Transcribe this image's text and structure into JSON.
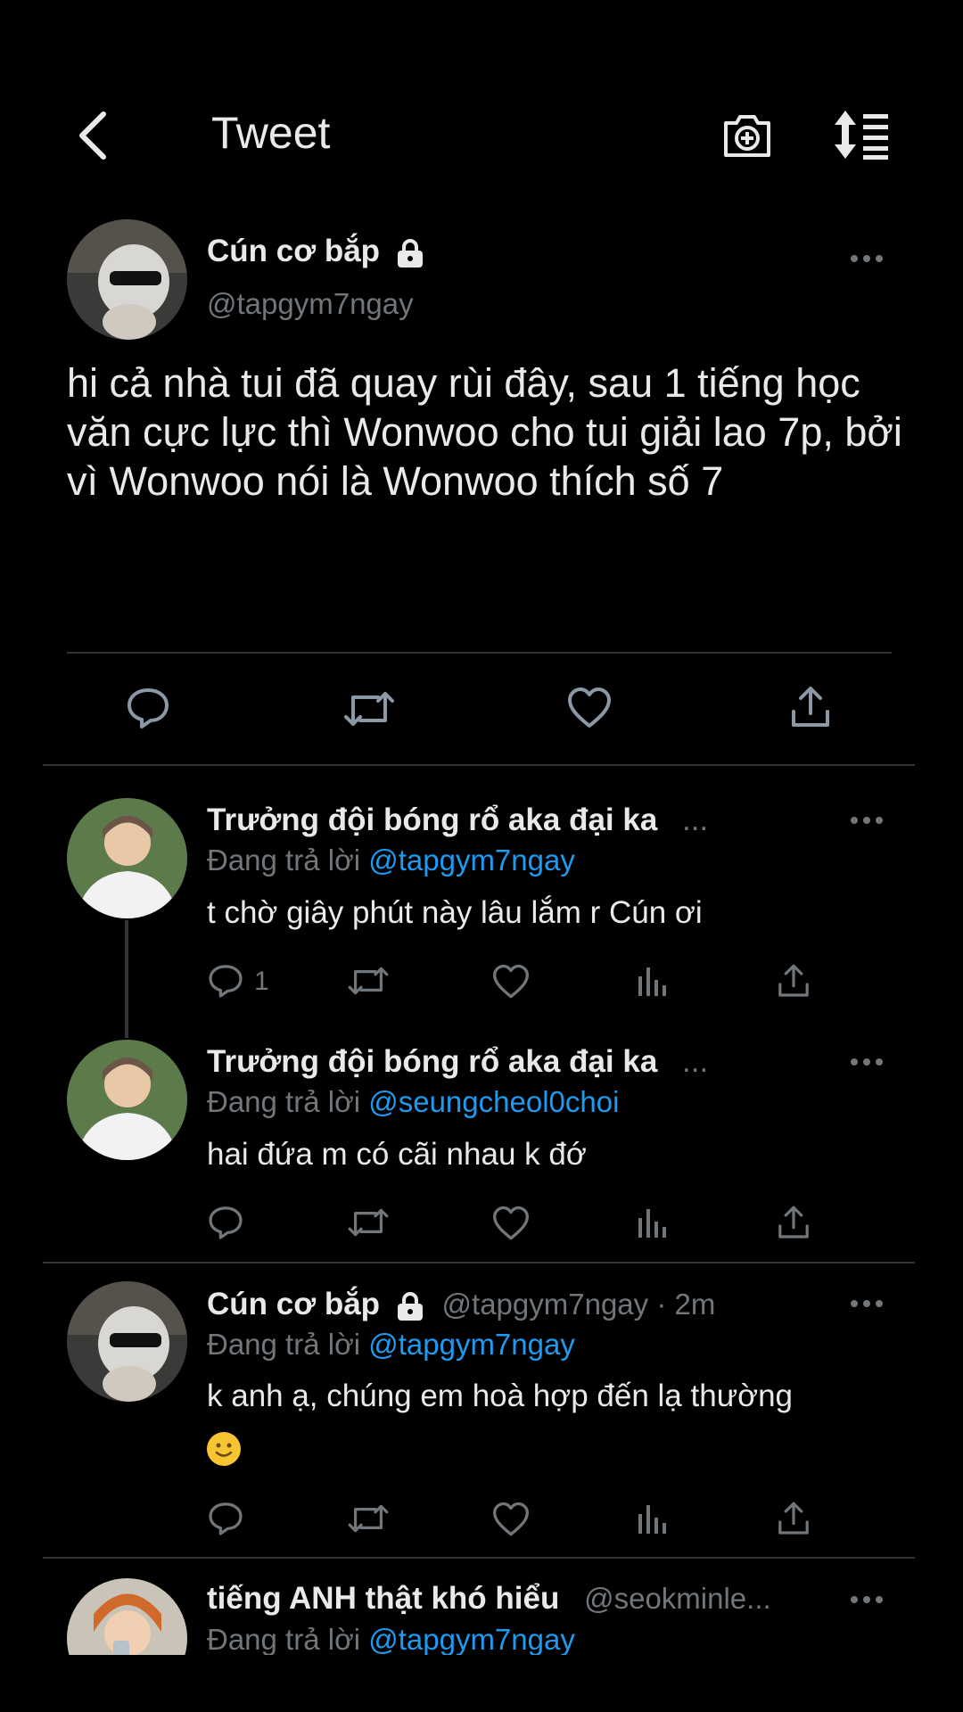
{
  "header": {
    "title": "Tweet",
    "back_icon": "chevron-left-icon",
    "camera_icon": "camera-plus-icon",
    "sort_icon": "sort-list-icon"
  },
  "main_tweet": {
    "display_name": "Cún cơ bắp",
    "handle": "@tapgym7ngay",
    "text": "hi cả nhà tui đã quay rùi đây, sau  1 tiếng học văn cực lực thì Wonwoo cho tui giải lao 7p, bởi vì Wonwoo nói là Wonwoo thích số 7",
    "locked": true
  },
  "replies": [
    {
      "display_name": "Trưởng đội bóng rổ aka đại ka",
      "ellipsis": "...",
      "replying_prefix": "Đang trả lời",
      "replying_to": "@tapgym7ngay",
      "text": "t chờ giây phút này lâu lắm r Cún ơi",
      "reply_count": "1"
    },
    {
      "display_name": "Trưởng đội bóng rổ aka đại ka",
      "ellipsis": "...",
      "replying_prefix": "Đang trả lời",
      "replying_to": "@seungcheol0choi",
      "text": "hai đứa m có cãi nhau k đớ"
    },
    {
      "display_name": "Cún cơ bắp",
      "meta": "@tapgym7ngay · 2m",
      "replying_prefix": "Đang trả lời",
      "replying_to": "@tapgym7ngay",
      "text": "k anh ạ, chúng em hoà hợp đến lạ thường",
      "emoji": "slightly-smiling-face"
    },
    {
      "display_name": "tiếng ANH thật khó hiểu",
      "meta": "@seokminle...",
      "replying_prefix": "Đang trả lời",
      "replying_to": "@tapgym7ngay"
    }
  ],
  "colors": {
    "background": "#000000",
    "text": "#e7e9ea",
    "secondary": "#71767b",
    "accent": "#1d9bf0",
    "divider": "#2f3336"
  }
}
